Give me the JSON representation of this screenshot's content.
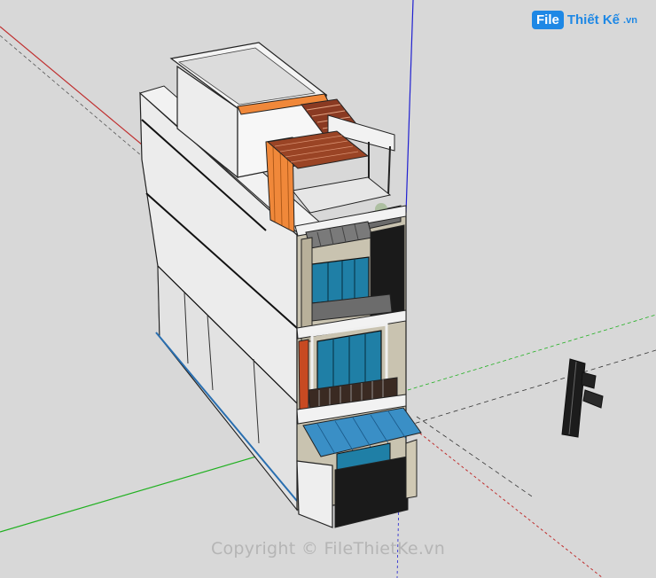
{
  "watermark": {
    "logo_file": "File",
    "logo_name": "Thiết Kế",
    "logo_domain": ".vn"
  },
  "copyright": "Copyright © FileThietKe.vn",
  "colors": {
    "background": "#d8d8d8",
    "axis_red": "#c03030",
    "axis_green": "#20b020",
    "axis_blue": "#2020d0",
    "wall": "#e6e6e6",
    "glass": "#1f7fa6",
    "accent_orange": "#f0883a",
    "wood": "#a04a2a"
  }
}
